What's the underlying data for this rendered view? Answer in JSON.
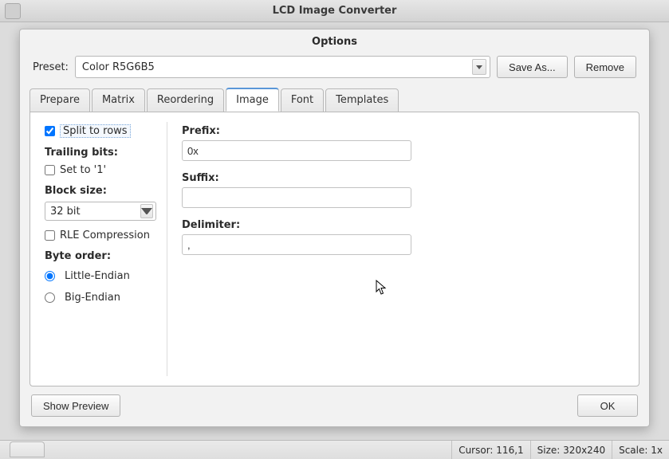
{
  "window": {
    "title": "LCD Image Converter"
  },
  "dialog": {
    "title": "Options"
  },
  "preset": {
    "label": "Preset:",
    "value": "Color R5G6B5",
    "save_as": "Save As...",
    "remove": "Remove"
  },
  "tabs": [
    {
      "label": "Prepare"
    },
    {
      "label": "Matrix"
    },
    {
      "label": "Reordering"
    },
    {
      "label": "Image"
    },
    {
      "label": "Font"
    },
    {
      "label": "Templates"
    }
  ],
  "active_tab": 3,
  "image_tab": {
    "split_to_rows": {
      "label": "Split to rows",
      "checked": true
    },
    "trailing_bits_label": "Trailing bits:",
    "set_to_1": {
      "label": "Set to '1'",
      "checked": false
    },
    "block_size_label": "Block size:",
    "block_size_value": "32 bit",
    "rle": {
      "label": "RLE Compression",
      "checked": false
    },
    "byte_order_label": "Byte order:",
    "byte_order": {
      "little": "Little-Endian",
      "big": "Big-Endian",
      "value": "little"
    },
    "prefix_label": "Prefix:",
    "prefix_value": "0x",
    "suffix_label": "Suffix:",
    "suffix_value": "",
    "delimiter_label": "Delimiter:",
    "delimiter_value": ","
  },
  "footer": {
    "show_preview": "Show Preview",
    "ok": "OK"
  },
  "status": {
    "cursor_label": "Cursor:",
    "cursor_value": "116,1",
    "size_label": "Size:",
    "size_value": "320x240",
    "scale_label": "Scale:",
    "scale_value": "1x"
  }
}
